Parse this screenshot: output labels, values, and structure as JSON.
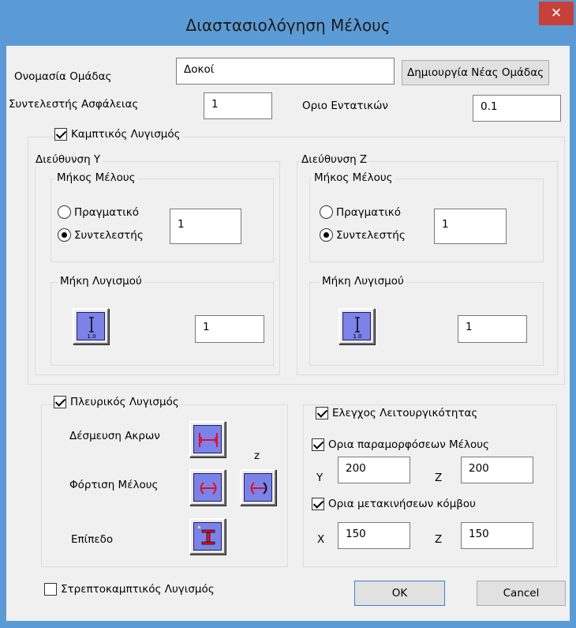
{
  "window": {
    "title": "Διαστασιολόγηση Μέλους",
    "close_glyph": "✕"
  },
  "top": {
    "group_name_label": "Ονομασία Ομάδας",
    "group_name_value": "Δοκοί",
    "new_group_button": "Δημιουργία Νέας Ομάδας",
    "safety_factor_label": "Συντελεστής Ασφάλειας",
    "safety_factor_value": "1",
    "stress_limit_label": "Οριο Εντατικών",
    "stress_limit_value": "0.1"
  },
  "flexural": {
    "checkbox_label": "Καμπτικός Λυγισμός",
    "checked": true,
    "dir_y": {
      "title": "Διεύθυνση Υ",
      "member_length_title": "Μήκος Μέλους",
      "radio_actual": "Πραγματικό",
      "radio_factor": "Συντελεστής",
      "selected": "factor",
      "factor_value": "1",
      "buckling_lengths_title": "Μήκη Λυγισμού",
      "buckling_value": "1",
      "icon": "buckling-length-icon",
      "icon_caption": "1.0"
    },
    "dir_z": {
      "title": "Διεύθυνση Ζ",
      "member_length_title": "Μήκος Μέλους",
      "radio_actual": "Πραγματικό",
      "radio_factor": "Συντελεστής",
      "selected": "factor",
      "factor_value": "1",
      "buckling_lengths_title": "Μήκη Λυγισμού",
      "buckling_value": "1",
      "icon": "buckling-length-icon",
      "icon_caption": "1.0"
    }
  },
  "lateral": {
    "checkbox_label": "Πλευρικός Λυγισμός",
    "checked": true,
    "end_restraint_label": "Δέσμευση Ακρων",
    "z_label": "z",
    "member_loading_label": "Φόρτιση Μέλους",
    "level_label": "Επίπεδο"
  },
  "serviceability": {
    "checkbox_label": "Ελεγχος Λειτουργικότητας",
    "checked": true,
    "deformation": {
      "checkbox_label": "Ορια παραμορφόσεων Μέλους",
      "checked": true,
      "y_label": "Y",
      "y_value": "200",
      "z_label": "Z",
      "z_value": "200"
    },
    "displacement": {
      "checkbox_label": "Ορια μετακινήσεων κόμβου",
      "checked": true,
      "x_label": "X",
      "x_value": "150",
      "z_label": "Z",
      "z_value": "150"
    }
  },
  "bottom": {
    "torsional_label": "Στρεπτοκαμπτικός  Λυγισμός",
    "torsional_checked": false,
    "ok_button": "OK",
    "cancel_button": "Cancel"
  },
  "colors": {
    "titlebar": "#5b9bd5",
    "close_button": "#c7403a",
    "dialog_bg": "#f0f0f0",
    "icon_face": "#7b83e8",
    "icon_symbol_red": "#e0102a",
    "ok_button_border": "#3c7fd1"
  }
}
